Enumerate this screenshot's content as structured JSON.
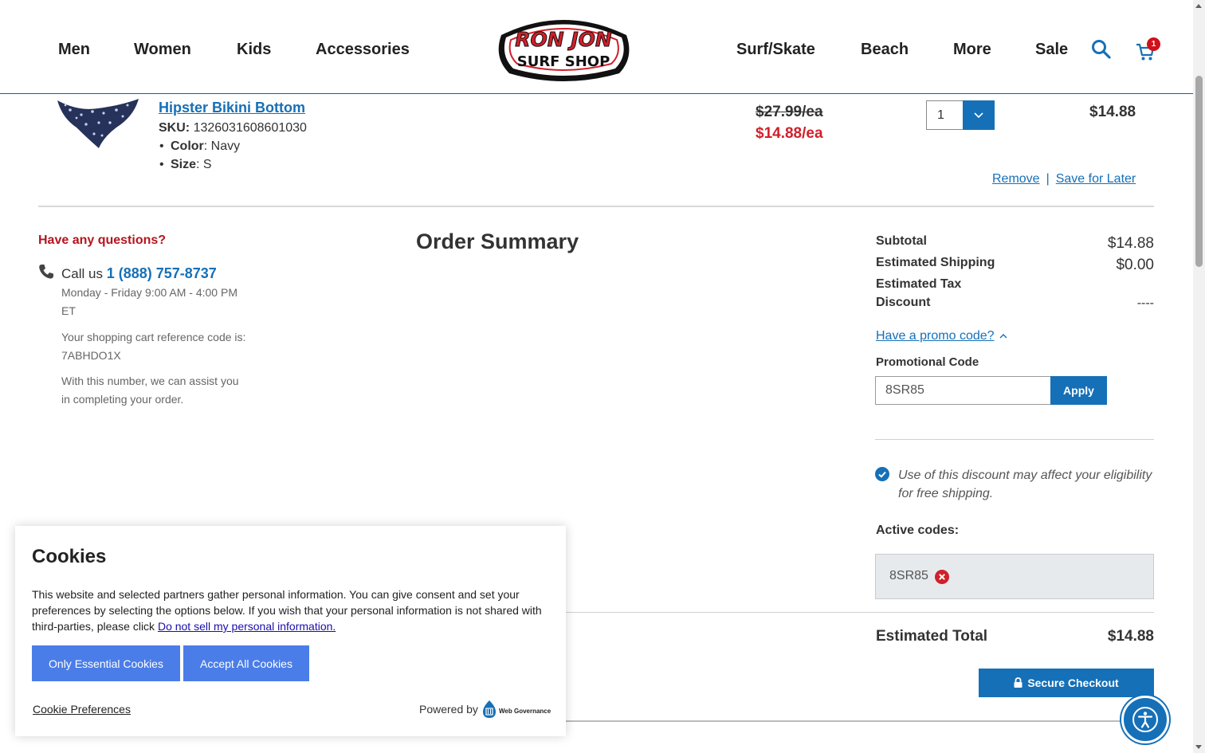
{
  "nav": {
    "left": [
      "Men",
      "Women",
      "Kids",
      "Accessories"
    ],
    "right": [
      "Surf/Skate",
      "Beach",
      "More",
      "Sale"
    ],
    "logo": {
      "line1": "RON JON",
      "line2": "SURF SHOP"
    },
    "cart_count": "1"
  },
  "item": {
    "name": "Hipster Bikini Bottom",
    "sku_label": "SKU:",
    "sku": "1326031608601030",
    "attributes": [
      {
        "label": "Color",
        "value": ": Navy"
      },
      {
        "label": "Size",
        "value": ": S"
      }
    ],
    "price_original": "$27.99/ea",
    "price_sale": "$14.88/ea",
    "quantity": "1",
    "line_total": "$14.88",
    "remove": "Remove",
    "separator": "|",
    "save_for_later": "Save for Later"
  },
  "help": {
    "title": "Have any questions?",
    "call_prefix": "Call us ",
    "phone": "1 (888) 757-8737",
    "hours": "Monday - Friday 9:00 AM - 4:00 PM ET",
    "reference": "Your shopping cart reference code is: 7ABHDO1X",
    "assist": "With this number, we can assist you in completing your order."
  },
  "summary": {
    "title": "Order Summary",
    "subtotal_label": "Subtotal",
    "subtotal": "$14.88",
    "shipping_label": "Estimated Shipping",
    "shipping": "$0.00",
    "tax_label": "Estimated Tax",
    "discount_label": "Discount",
    "discount": "----",
    "promo_link": "Have a promo code?",
    "promo_label": "Promotional Code",
    "promo_value": "8SR85",
    "apply": "Apply",
    "discount_note": "Use of this discount may affect your eligibility for free shipping.",
    "active_codes_label": "Active codes:",
    "active_code": "8SR85",
    "estimated_total_label": "Estimated Total",
    "estimated_total": "$14.88",
    "checkout": "Secure Checkout"
  },
  "cookie": {
    "title": "Cookies",
    "text": "This website and selected partners gather personal information. You can give consent and set your preferences by selecting the options below. If you wish that your personal information is not shared with third-parties, please click ",
    "link": "Do not sell my personal information.",
    "essential": "Only Essential Cookies",
    "accept_all": "Accept All Cookies",
    "preferences": "Cookie Preferences",
    "powered_by": "Powered by",
    "powered_logo": "Web Governance"
  },
  "colors": {
    "brand_blue": "#1570b8",
    "sale_red": "#d0202b",
    "cookie_button": "#4a7de8"
  }
}
